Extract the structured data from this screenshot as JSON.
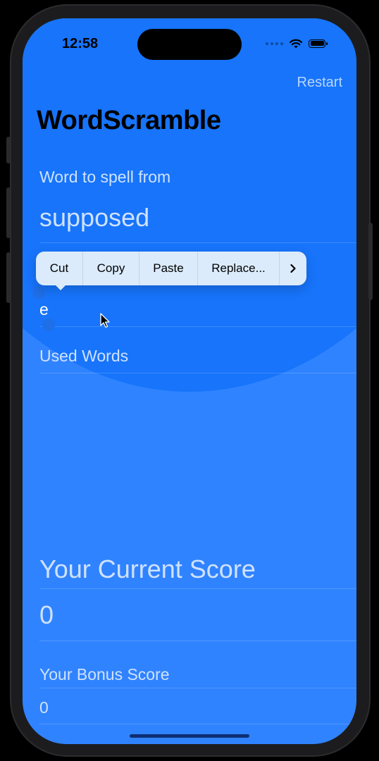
{
  "status": {
    "time": "12:58"
  },
  "nav": {
    "restart": "Restart",
    "title": "WordScramble"
  },
  "root_word": {
    "label": "Word to spell from",
    "value": "supposed"
  },
  "input": {
    "value": "e"
  },
  "edit_menu": {
    "items": [
      "Cut",
      "Copy",
      "Paste",
      "Replace..."
    ],
    "more": "›"
  },
  "used_words": {
    "label": "Used Words",
    "items": []
  },
  "score": {
    "current_label": "Your Current Score",
    "current_value": "0",
    "bonus_label": "Your Bonus Score",
    "bonus_value": "0"
  },
  "colors": {
    "background": "#3083ff",
    "header_background": "#1774fb",
    "menu": "#dbebfb"
  },
  "icons": [
    "wifi-icon",
    "battery-icon",
    "chevron-right-icon",
    "mouse-pointer-icon"
  ]
}
